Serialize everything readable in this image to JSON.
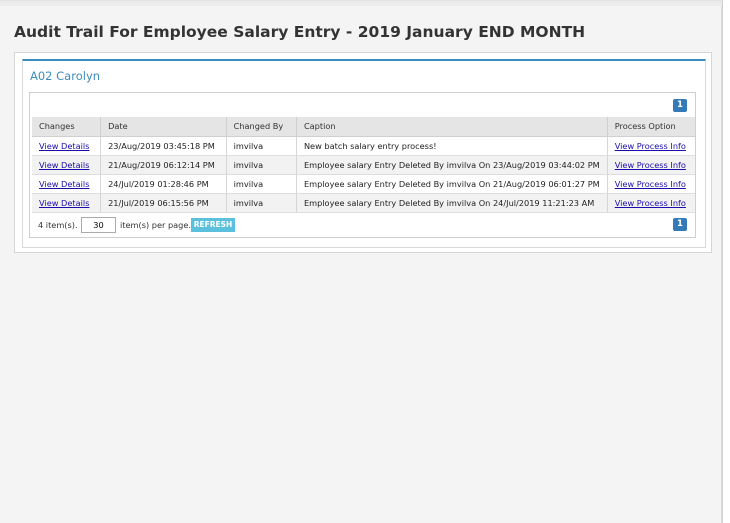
{
  "page": {
    "title": "Audit Trail For Employee Salary Entry - 2019 January END MONTH"
  },
  "panel": {
    "header": "A02 Carolyn"
  },
  "grid": {
    "columns": [
      "Changes",
      "Date",
      "Changed By",
      "Caption",
      "Process Option"
    ],
    "rows": [
      {
        "changes": "View Details",
        "date": "23/Aug/2019 03:45:18 PM",
        "changed_by": "imvilva",
        "caption": "New batch salary entry process!",
        "process_option": "View Process Info"
      },
      {
        "changes": "View Details",
        "date": "21/Aug/2019 06:12:14 PM",
        "changed_by": "imvilva",
        "caption": "Employee salary Entry Deleted By imvilva On 23/Aug/2019 03:44:02 PM",
        "process_option": "View Process Info"
      },
      {
        "changes": "View Details",
        "date": "24/Jul/2019 01:28:46 PM",
        "changed_by": "imvilva",
        "caption": "Employee salary Entry Deleted By imvilva On 21/Aug/2019 06:01:27 PM",
        "process_option": "View Process Info"
      },
      {
        "changes": "View Details",
        "date": "21/Jul/2019 06:15:56 PM",
        "changed_by": "imvilva",
        "caption": "Employee salary Entry Deleted By imvilva On 24/Jul/2019 11:21:23 AM",
        "process_option": "View Process Info"
      }
    ],
    "pager": {
      "current_page": "1",
      "item_count": "4 item(s).",
      "page_size": "30",
      "per_page_label": "item(s) per page.",
      "refresh_label": "REFRESH"
    }
  },
  "colors": {
    "accent": "#3c8dbc",
    "badge": "#337ab7",
    "refresh": "#5bc0de",
    "link": "#1a0dab"
  }
}
